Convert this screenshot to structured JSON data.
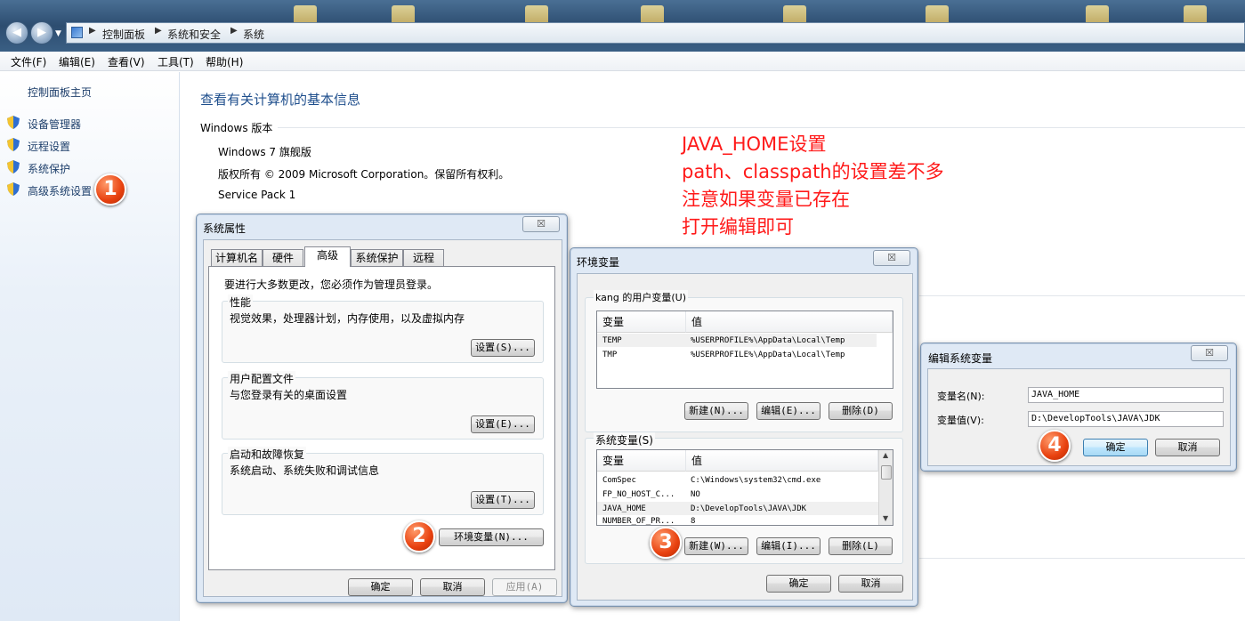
{
  "addressbar": {
    "crumbs": [
      "控制面板",
      "系统和安全",
      "系统"
    ]
  },
  "menu": [
    "文件(F)",
    "编辑(E)",
    "查看(V)",
    "工具(T)",
    "帮助(H)"
  ],
  "leftnav": {
    "home": "控制面板主页",
    "links": [
      "设备管理器",
      "远程设置",
      "系统保护",
      "高级系统设置"
    ]
  },
  "main": {
    "title": "查看有关计算机的基本信息",
    "section": "Windows 版本",
    "edition": "Windows 7 旗舰版",
    "copyright": "版权所有 © 2009 Microsoft Corporation。保留所有权利。",
    "servicepack": "Service Pack 1"
  },
  "annotation": {
    "lines": [
      "JAVA_HOME设置",
      "path、classpath的设置差不多",
      "注意如果变量已存在",
      "打开编辑即可"
    ],
    "badges": [
      "1",
      "2",
      "3",
      "4"
    ]
  },
  "sysprops": {
    "title": "系统属性",
    "close": "☒",
    "tabs": [
      "计算机名",
      "硬件",
      "高级",
      "系统保护",
      "远程"
    ],
    "admin_note": "要进行大多数更改，您必须作为管理员登录。",
    "perf": {
      "title": "性能",
      "desc": "视觉效果，处理器计划，内存使用，以及虚拟内存",
      "button": "设置(S)..."
    },
    "profile": {
      "title": "用户配置文件",
      "desc": "与您登录有关的桌面设置",
      "button": "设置(E)..."
    },
    "startup": {
      "title": "启动和故障恢复",
      "desc": "系统启动、系统失败和调试信息",
      "button": "设置(T)..."
    },
    "envbutton": "环境变量(N)...",
    "ok": "确定",
    "cancel": "取消",
    "apply": "应用(A)"
  },
  "envvars": {
    "title": "环境变量",
    "close": "☒",
    "user_group": "kang 的用户变量(U)",
    "col_var": "变量",
    "col_val": "值",
    "user_rows": [
      {
        "name": "TEMP",
        "value": "%USERPROFILE%\\AppData\\Local\\Temp"
      },
      {
        "name": "TMP",
        "value": "%USERPROFILE%\\AppData\\Local\\Temp"
      }
    ],
    "user_new": "新建(N)...",
    "user_edit": "编辑(E)...",
    "user_delete": "删除(D)",
    "sys_group": "系统变量(S)",
    "sys_rows": [
      {
        "name": "ComSpec",
        "value": "C:\\Windows\\system32\\cmd.exe"
      },
      {
        "name": "FP_NO_HOST_C...",
        "value": "NO"
      },
      {
        "name": "JAVA_HOME",
        "value": "D:\\DevelopTools\\JAVA\\JDK"
      },
      {
        "name": "NUMBER_OF_PR...",
        "value": "8"
      }
    ],
    "sys_new": "新建(W)...",
    "sys_edit": "编辑(I)...",
    "sys_delete": "删除(L)",
    "ok": "确定",
    "cancel": "取消"
  },
  "editvar": {
    "title": "编辑系统变量",
    "close": "☒",
    "name_label": "变量名(N):",
    "name_value": "JAVA_HOME",
    "value_label": "变量值(V):",
    "value_value": "D:\\DevelopTools\\JAVA\\JDK",
    "ok": "确定",
    "cancel": "取消"
  }
}
